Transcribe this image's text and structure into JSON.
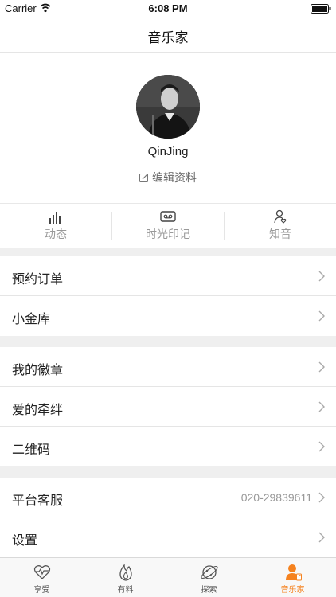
{
  "status_bar": {
    "carrier": "Carrier",
    "time": "6:08 PM"
  },
  "nav": {
    "title": "音乐家"
  },
  "profile": {
    "username": "QinJing",
    "edit_label": "编辑资料"
  },
  "stats": [
    {
      "label": "动态",
      "icon": "bar-chart-icon"
    },
    {
      "label": "时光印记",
      "icon": "cassette-icon"
    },
    {
      "label": "知音",
      "icon": "person-heart-icon"
    }
  ],
  "menu": {
    "orders": "预约订单",
    "vault": "小金库",
    "badges": "我的徽章",
    "bond": "爱的牵绊",
    "qrcode": "二维码",
    "service": "平台客服",
    "service_phone": "020-29839611",
    "settings": "设置"
  },
  "tabs": [
    {
      "label": "享受",
      "icon": "heartbeat-icon",
      "active": false
    },
    {
      "label": "有料",
      "icon": "flame-icon",
      "active": false
    },
    {
      "label": "探索",
      "icon": "planet-icon",
      "active": false
    },
    {
      "label": "音乐家",
      "icon": "musician-icon",
      "active": true
    }
  ],
  "colors": {
    "accent": "#f5821f",
    "background": "#efefef",
    "text": "#222222",
    "muted": "#999999"
  }
}
